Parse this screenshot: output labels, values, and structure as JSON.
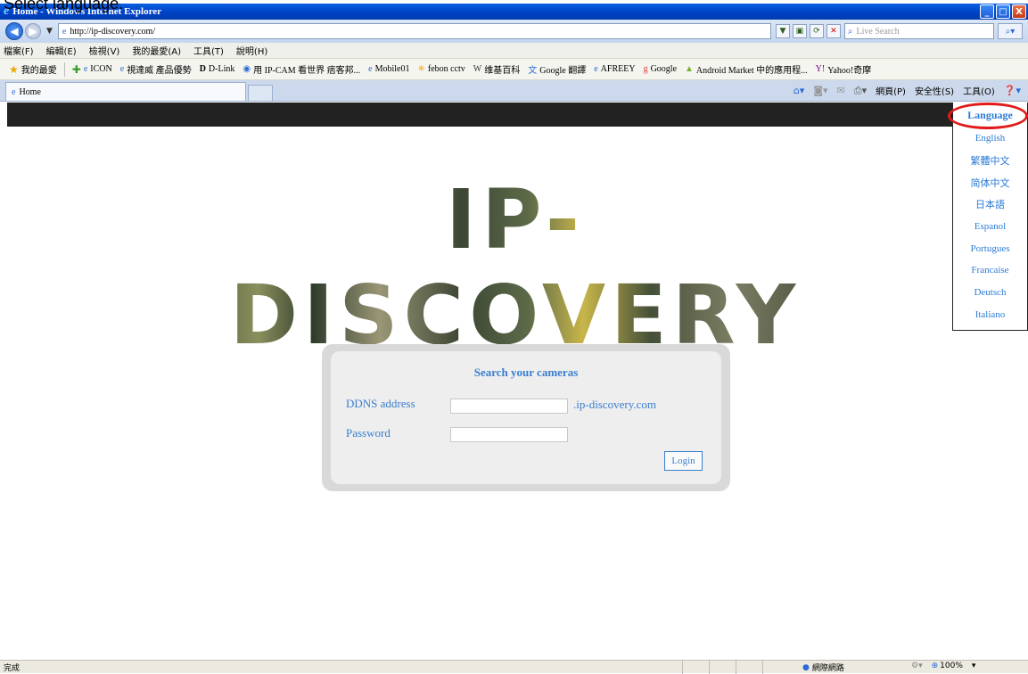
{
  "caption": "Select language.",
  "window": {
    "title": "Home - Windows Internet Explorer",
    "minimize": "_",
    "maximize": "□",
    "close": "X"
  },
  "addressbar": {
    "url": "http://ip-discovery.com/",
    "search_placeholder": "Live Search"
  },
  "menubar": {
    "items": [
      "檔案(F)",
      "編輯(E)",
      "檢視(V)",
      "我的最愛(A)",
      "工具(T)",
      "說明(H)"
    ]
  },
  "favorites": {
    "label": "我的最愛",
    "items": [
      "ICON",
      "視達威 產品優勢",
      "D-Link",
      "用 IP-CAM 看世界 痞客邦...",
      "Mobile01",
      "febon cctv",
      "维基百科",
      "Google 翻譯",
      "AFREEY",
      "Google",
      "Android Market 中的應用程...",
      "Yahoo!奇摩"
    ]
  },
  "tabs": [
    {
      "label": "Home"
    }
  ],
  "commandbar": {
    "page": "網頁(P)",
    "safety": "安全性(S)",
    "tools": "工具(O)"
  },
  "site": {
    "logo": "IP-DISCOVERY",
    "language_header": "Language",
    "languages": [
      "English",
      "繁體中文",
      "简体中文",
      "日本語",
      "Espanol",
      "Portugues",
      "Francaise",
      "Deutsch",
      "Italiano"
    ],
    "login": {
      "title": "Search your cameras",
      "ddns_label": "DDNS address",
      "ddns_suffix": ".ip-discovery.com",
      "password_label": "Password",
      "button": "Login"
    }
  },
  "status": {
    "text": "完成",
    "zone": "網際網路",
    "zoom": "100%"
  },
  "colors": {
    "link_blue": "#3a7fcf",
    "highlight_ring": "#e21a1a",
    "top_strip": "#222222"
  }
}
